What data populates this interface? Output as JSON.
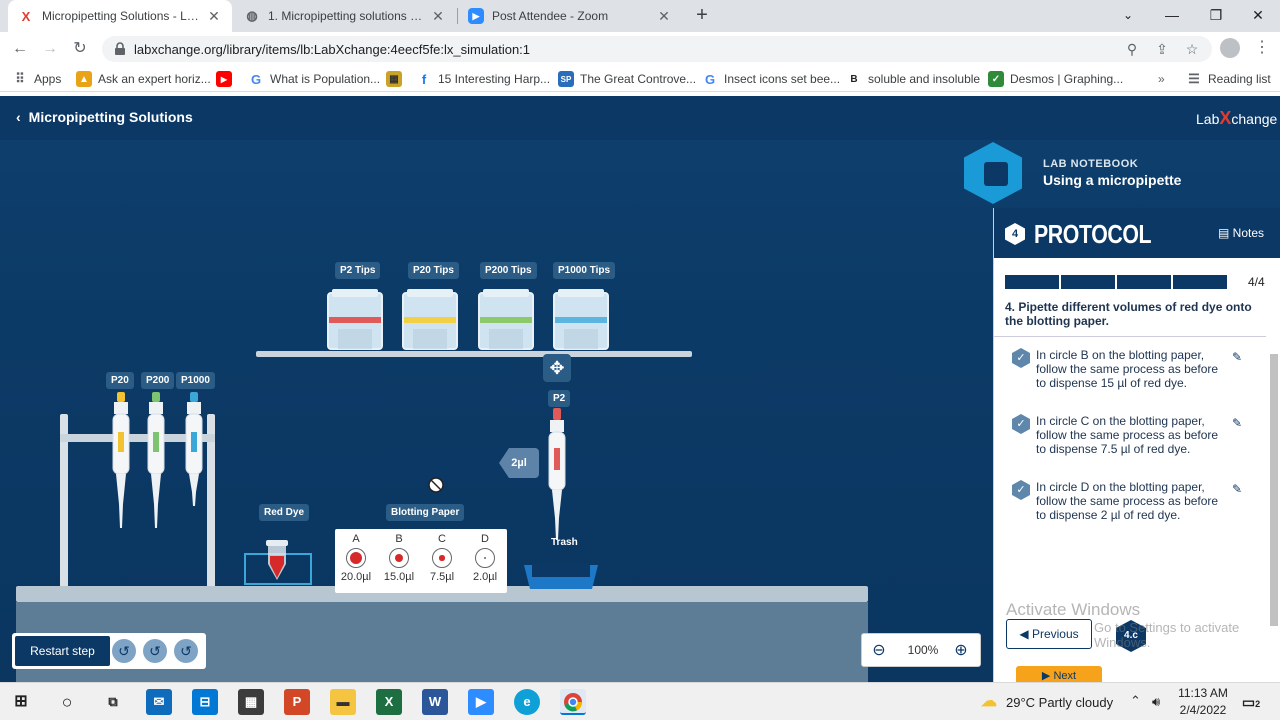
{
  "browser": {
    "tabs": [
      {
        "title": "Micropipetting Solutions - LabXchange",
        "active": true,
        "favicon": "labxchange-x-icon"
      },
      {
        "title": "1. Micropipetting solutions virtual lab",
        "active": false,
        "favicon": "globe-icon"
      },
      {
        "title": "Post Attendee - Zoom",
        "active": false,
        "favicon": "zoom-icon"
      }
    ],
    "url": "labxchange.org/library/items/lb:LabXchange:4eecf5fe:lx_simulation:1",
    "bookmarks": [
      {
        "label": "Apps",
        "icon": "apps-grid-icon"
      },
      {
        "label": "Ask an expert horiz...",
        "icon": "chegg-icon"
      },
      {
        "label": "",
        "icon": "youtube-icon"
      },
      {
        "label": "What is Population...",
        "icon": "google-icon"
      },
      {
        "label": "",
        "icon": "image-icon"
      },
      {
        "label": "15 Interesting Harp...",
        "icon": "facebook-icon"
      },
      {
        "label": "The Great Controve...",
        "icon": "site-icon"
      },
      {
        "label": "Insect icons set bee...",
        "icon": "google-icon"
      },
      {
        "label": "soluble and insoluble",
        "icon": "bing-icon"
      },
      {
        "label": "Desmos | Graphing...",
        "icon": "desmos-icon"
      }
    ],
    "reading_list": "Reading list"
  },
  "app": {
    "back_title": "Micropipetting Solutions",
    "brand": {
      "pre": "Lab",
      "x": "X",
      "post": "change"
    },
    "tip_boxes": [
      {
        "label": "P2 Tips",
        "color": "#e05a5a"
      },
      {
        "label": "P20 Tips",
        "color": "#f2d046"
      },
      {
        "label": "P200 Tips",
        "color": "#8cc96a"
      },
      {
        "label": "P1000 Tips",
        "color": "#5bb5e0"
      }
    ],
    "rack_pipettes": [
      {
        "label": "P20",
        "color": "#f2c230"
      },
      {
        "label": "P200",
        "color": "#7dc470"
      },
      {
        "label": "P1000",
        "color": "#3aa7d8"
      }
    ],
    "active_pipette": {
      "label": "P2",
      "volume": "2µl",
      "color": "#e05a5a"
    },
    "red_dye_label": "Red Dye",
    "blotting_paper_label": "Blotting Paper",
    "spots": [
      {
        "letter": "A",
        "volume": "20.0µl",
        "filled": 1.0
      },
      {
        "letter": "B",
        "volume": "15.0µl",
        "filled": 0.6
      },
      {
        "letter": "C",
        "volume": "7.5µl",
        "filled": 0.25
      },
      {
        "letter": "D",
        "volume": "2.0µl",
        "filled": 0.0
      }
    ],
    "trash_label": "Trash",
    "restart_label": "Restart step",
    "zoom_value": "100%"
  },
  "notebook": {
    "kicker": "LAB NOTEBOOK",
    "title": "Using a micropipette",
    "step_number": "4",
    "section": "PROTOCOL",
    "notes_label": "Notes",
    "progress_text": "4/4",
    "progress": 1.0,
    "step_text": "4. Pipette different volumes of red dye onto the blotting paper.",
    "tasks": [
      {
        "text": "In circle B on the blotting paper, follow the same process as before to dispense 15 µl of red dye."
      },
      {
        "text": "In circle C on the blotting paper, follow the same process as before to dispense 7.5 µl of red dye."
      },
      {
        "text": "In circle D on the blotting paper, follow the same process as before to dispense 2 µl of red dye."
      }
    ],
    "previous_label": "Previous",
    "step_badge": "4.c",
    "next_label": "Next"
  },
  "watermark": {
    "line1": "Activate Windows",
    "line2": "Go to Settings to activate Windows."
  },
  "taskbar": {
    "weather": "29°C  Partly cloudy",
    "time": "11:13 AM",
    "date": "2/4/2022",
    "notifications": "2"
  }
}
